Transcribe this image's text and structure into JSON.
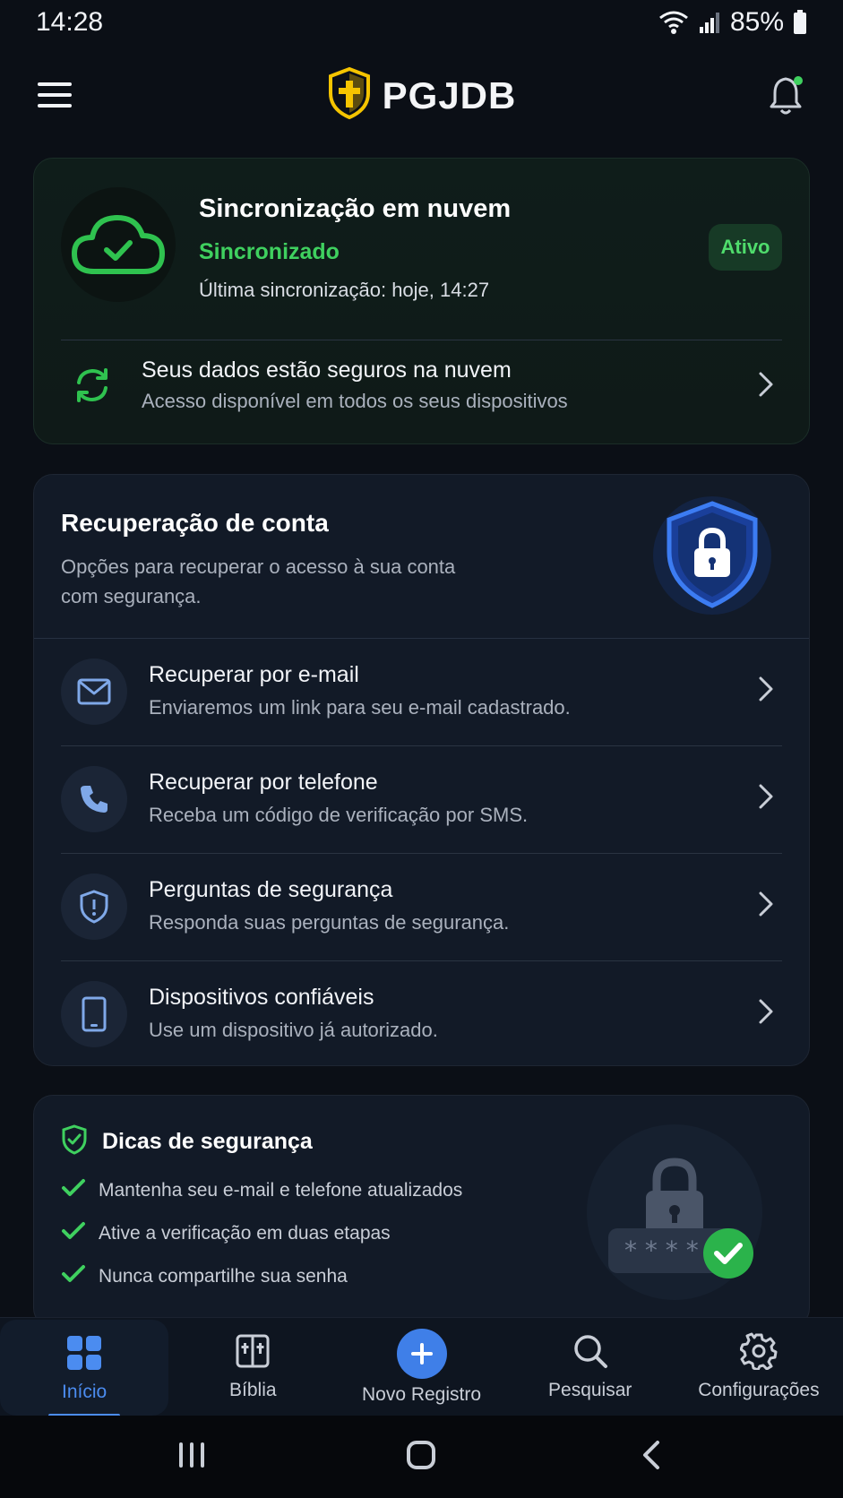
{
  "status_bar": {
    "time": "14:28",
    "battery": "85%"
  },
  "header": {
    "app_name": "PGJDB"
  },
  "sync": {
    "title": "Sincronização em nuvem",
    "status": "Sincronizado",
    "last_sync": "Última sincronização: hoje, 14:27",
    "badge": "Ativo",
    "row_title": "Seus dados estão seguros na nuvem",
    "row_subtitle": "Acesso disponível em todos os seus dispositivos"
  },
  "recovery": {
    "title": "Recuperação de conta",
    "description": "Opções para recuperar o acesso à sua conta com segurança.",
    "items": [
      {
        "title": "Recuperar por e-mail",
        "subtitle": "Enviaremos um link para seu e-mail cadastrado.",
        "icon": "mail-icon"
      },
      {
        "title": "Recuperar por telefone",
        "subtitle": "Receba um código de verificação por SMS.",
        "icon": "phone-icon"
      },
      {
        "title": "Perguntas de segurança",
        "subtitle": "Responda suas perguntas de segurança.",
        "icon": "shield-alert-icon"
      },
      {
        "title": "Dispositivos confiáveis",
        "subtitle": "Use um dispositivo já autorizado.",
        "icon": "tablet-icon"
      }
    ]
  },
  "tips": {
    "title": "Dicas de segurança",
    "items": [
      "Mantenha seu e-mail e telefone atualizados",
      "Ative a verificação em duas etapas",
      "Nunca compartilhe sua senha"
    ]
  },
  "bottom_nav": {
    "items": [
      {
        "label": "Início",
        "icon": "grid-icon",
        "active": true
      },
      {
        "label": "Bíblia",
        "icon": "book-icon",
        "active": false
      },
      {
        "label": "Novo Registro",
        "icon": "plus-icon",
        "active": false
      },
      {
        "label": "Pesquisar",
        "icon": "search-icon",
        "active": false
      },
      {
        "label": "Configurações",
        "icon": "gear-icon",
        "active": false
      }
    ]
  },
  "colors": {
    "background": "#0b0f16",
    "card": "#121a27",
    "accent_green": "#3fd05f",
    "accent_blue": "#4b8cf0",
    "logo_gold": "#f5c400"
  }
}
